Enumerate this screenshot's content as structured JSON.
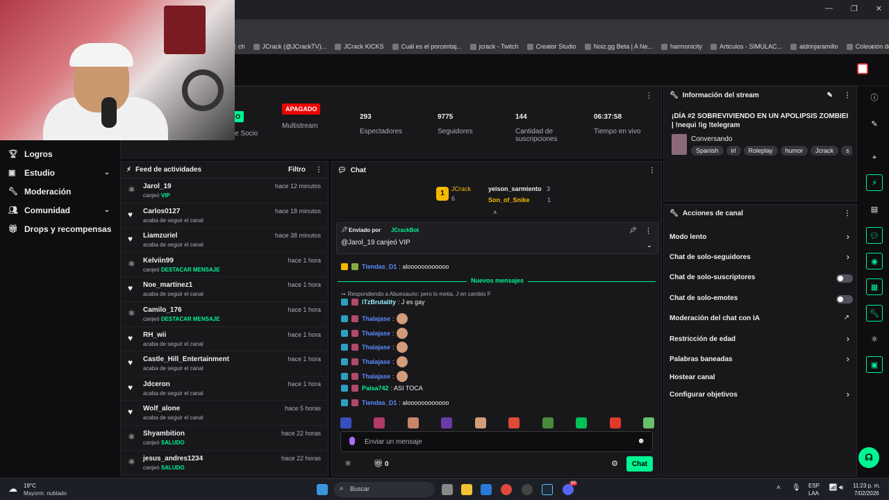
{
  "browser": {
    "bookmarks": [
      "ch",
      "JCrack (@JCrackTV)...",
      "JCrack KICKS",
      "Cuál es el porcentaj...",
      "jcrack - Twitch",
      "Creator Studio",
      "Noiz.gg Beta | A Ne...",
      "harmonicity",
      "Articulos - SIMULAC...",
      "aldrinjaramillo",
      "Colección de M_blei..."
    ]
  },
  "nav": {
    "items": [
      {
        "label": "Logros"
      },
      {
        "label": "Estudio"
      },
      {
        "label": "Moderación"
      },
      {
        "label": "Comunidad"
      },
      {
        "label": "Drops y recompensas"
      }
    ]
  },
  "stats": {
    "partner_badge": "O",
    "partner_label": "e Socio",
    "multistream_badge": "APAGADO",
    "multistream_label": "Multistream",
    "viewers_value": "293",
    "viewers_label": "Espectadores",
    "followers_value": "9775",
    "followers_label": "Seguidores",
    "subs_value": "144",
    "subs_label": "Cantidad de suscripciones",
    "live_time_value": "06:37:58",
    "live_time_label": "Tiempo en vivo"
  },
  "feed": {
    "title": "Feed de actividades",
    "filter_label": "Filtro",
    "items": [
      {
        "name": "Jarol_19",
        "time": "hace 12 minutos",
        "action": "canjeó",
        "reward": "VIP"
      },
      {
        "name": "Carlos0127",
        "time": "hace 18 minutos",
        "action": "acaba de seguir el canal",
        "reward": ""
      },
      {
        "name": "Liamzuriel",
        "time": "hace 38 minutos",
        "action": "acaba de seguir el canal",
        "reward": ""
      },
      {
        "name": "Kelviin99",
        "time": "hace 1 hora",
        "action": "canjeó",
        "reward": "DESTACAR MENSAJE"
      },
      {
        "name": "Noe_martinez1",
        "time": "hace 1 hora",
        "action": "acaba de seguir el canal",
        "reward": ""
      },
      {
        "name": "Camilo_176",
        "time": "hace 1 hora",
        "action": "canjeó",
        "reward": "DESTACAR MENSAJE"
      },
      {
        "name": "RH_wii",
        "time": "hace 1 hora",
        "action": "acaba de seguir el canal",
        "reward": ""
      },
      {
        "name": "Castle_Hill_Entertainment",
        "time": "hace 1 hora",
        "action": "acaba de seguir el canal",
        "reward": ""
      },
      {
        "name": "Jdceron",
        "time": "hace 1 hora",
        "action": "acaba de seguir el canal",
        "reward": ""
      },
      {
        "name": "Wolf_alone",
        "time": "hace 5 horas",
        "action": "acaba de seguir el canal",
        "reward": ""
      },
      {
        "name": "Shyambition",
        "time": "hace 22 horas",
        "action": "canjeó",
        "reward": "SALUDO"
      },
      {
        "name": "jesus_andres1234",
        "time": "hace 22 horas",
        "action": "canjeó",
        "reward": "SALUDO"
      }
    ]
  },
  "chat": {
    "title": "Chat",
    "leaderboard": {
      "rank1_name": "JCrack",
      "rank1_count": "6",
      "rank2_name": "yeison_sarmiento",
      "rank2_count": "3",
      "rank3_name": "Son_of_Snike",
      "rank3_count": "1"
    },
    "pinned": {
      "prefix": "Enviado por",
      "sender": "JCrackBot",
      "message": "@Jarol_19 canjeó VIP"
    },
    "msg_before": {
      "user": "Tiendas_D1",
      "text": ": aloooooooooooo"
    },
    "new_messages_label": "Nuevos mensajes",
    "reply_note": "Respondiendo a Abuesaurio: pero lo metia, J en cambio F",
    "messages": [
      {
        "user": "iTzBrutality",
        "text": ": J es gay",
        "color": "#9cf0ff"
      },
      {
        "user": "Thalajase",
        "text": ":",
        "color": "#5c8bff"
      },
      {
        "user": "Thalajase",
        "text": ":",
        "color": "#5c8bff"
      },
      {
        "user": "Thalajase",
        "text": ":",
        "color": "#5c8bff"
      },
      {
        "user": "Thalajase",
        "text": ":",
        "color": "#5c8bff"
      },
      {
        "user": "Thalajase",
        "text": ":",
        "color": "#5c8bff"
      },
      {
        "user": "Paisa742",
        "text": ": ASI TOCA",
        "color": "#00f593"
      },
      {
        "user": "Tiendas_D1",
        "text": ": aloooooooooooo",
        "color": "#5c8bff"
      }
    ],
    "input_placeholder": "Enviar un mensaje",
    "points_value": "0",
    "send_label": "Chat"
  },
  "stream_info": {
    "heading": "Información del stream",
    "title": "¡DÍA #2 SOBREVIVIENDO EN UN ZOMBIEI | !nequi !ig !telegram",
    "title_display": "¡DÍA #2 SOBREVIVIENDO EN UN APOLIPSIS ZOMBIEI | !nequi !ig !telegram",
    "category": "Conversando",
    "tags": [
      "Spanish",
      "irl",
      "Roleplay",
      "humor",
      "Jcrack",
      "s"
    ]
  },
  "channel_actions": {
    "heading": "Acciones de canal",
    "items": [
      "Modo lento",
      "Chat de solo-seguidores",
      "Chat de solo-suscriptores",
      "Chat de solo-emotes",
      "Moderación del chat con IA",
      "Restricción de edad",
      "Palabras baneadas",
      "Hostear canal",
      "Configurar objetivos"
    ]
  },
  "taskbar": {
    "weather_temp": "19°C",
    "weather_desc": "Mayorm. nublado",
    "search_label": "Buscar",
    "lang1": "ESP",
    "lang2": "LAA",
    "time": "11:23 p. m.",
    "date": "7/02/2026",
    "notif_count": "99"
  }
}
